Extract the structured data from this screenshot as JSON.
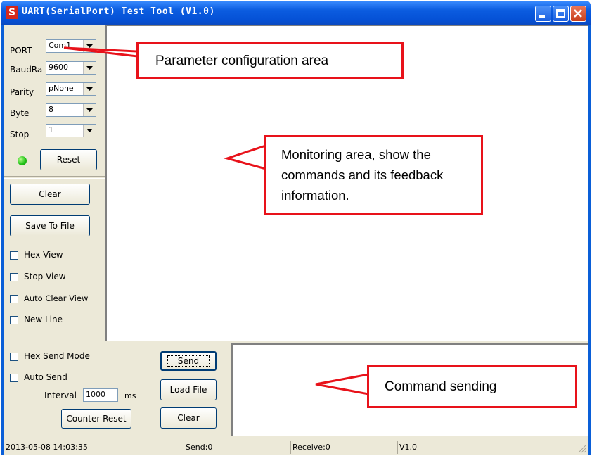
{
  "window": {
    "title": "UART(SerialPort) Test Tool (V1.0)",
    "icon_letter": "S"
  },
  "params": [
    {
      "label": "PORT",
      "value": "Com1"
    },
    {
      "label": "BaudRa",
      "value": "9600"
    },
    {
      "label": "Parity",
      "value": "pNone"
    },
    {
      "label": "Byte",
      "value": "8"
    },
    {
      "label": "Stop",
      "value": "1"
    }
  ],
  "reset_label": "Reset",
  "clear_label": "Clear",
  "save_label": "Save To File",
  "view_options": [
    "Hex View",
    "Stop View",
    "Auto Clear View",
    "New Line"
  ],
  "send_options": [
    "Hex Send Mode",
    "Auto Send"
  ],
  "interval": {
    "label": "Interval",
    "value": "1000",
    "unit": "ms"
  },
  "counter_reset_label": "Counter Reset",
  "send_label": "Send",
  "load_file_label": "Load File",
  "clear2_label": "Clear",
  "status": {
    "datetime": "2013-05-08 14:03:35",
    "send": "Send:0",
    "receive": "Receive:0",
    "version": "V1.0"
  },
  "annotations": {
    "param_area": "Parameter configuration area",
    "monitor_area": "Monitoring area, show the commands and its feedback information.",
    "command_sending": "Command sending"
  },
  "colors": {
    "callout_border": "#e8121a",
    "titlebar": "#0b5ce0",
    "led": "#23c41a"
  }
}
